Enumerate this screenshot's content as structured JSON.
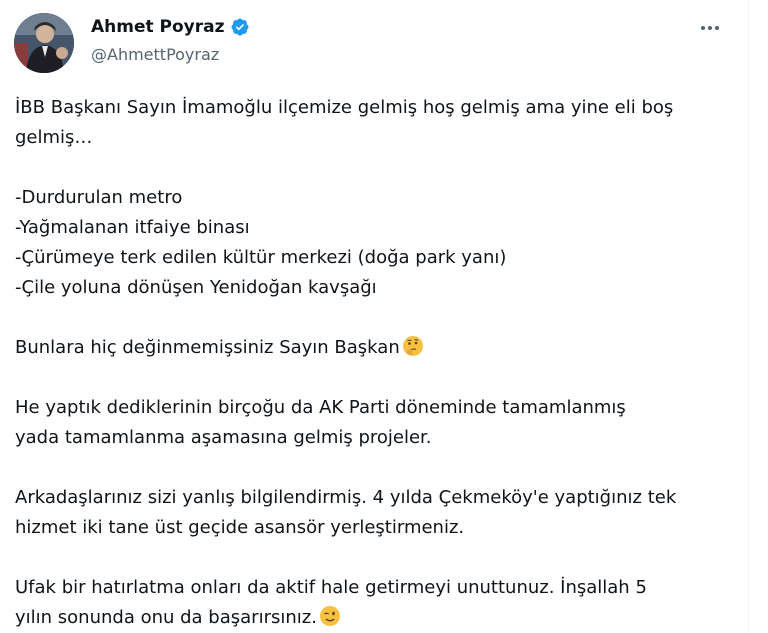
{
  "author": {
    "name": "Ahmet Poyraz",
    "handle": "@AhmettPoyraz",
    "verified": true
  },
  "menu": {
    "icon": "more-horizontal-icon"
  },
  "tweet": {
    "line1": "İBB Başkanı Sayın İmamoğlu ilçemize gelmiş hoş gelmiş ama yine eli boş",
    "line2": "gelmiş…",
    "list": [
      "-Durdurulan metro",
      "-Yağmalanan itfaiye binası",
      "-Çürümeye terk edilen kültür merkezi (doğa park yanı)",
      "-Çile yoluna dönüşen Yenidoğan kavşağı"
    ],
    "para2": "Bunlara hiç değinmemişsiniz Sayın Başkan",
    "para2_emoji": "thinking-face-emoji",
    "para3_l1": "He yaptık dediklerinin birçoğu da AK Parti döneminde tamamlanmış",
    "para3_l2": "yada tamamlanma aşamasına gelmiş projeler.",
    "para4_l1": "Arkadaşlarınız sizi yanlış bilgilendirmiş. 4 yılda Çekmeköy'e yaptığınız tek",
    "para4_l2": "hizmet iki tane üst geçide asansör yerleştirmeniz.",
    "para5_l1": "Ufak bir hatırlatma onları da aktif hale getirmeyi unuttunuz. İnşallah 5",
    "para5_l2": "yılın sonunda onu da başarırsınız.",
    "para5_emoji": "winking-face-emoji"
  },
  "colors": {
    "text": "#0f1419",
    "secondary": "#536471",
    "verified": "#1d9bf0"
  }
}
